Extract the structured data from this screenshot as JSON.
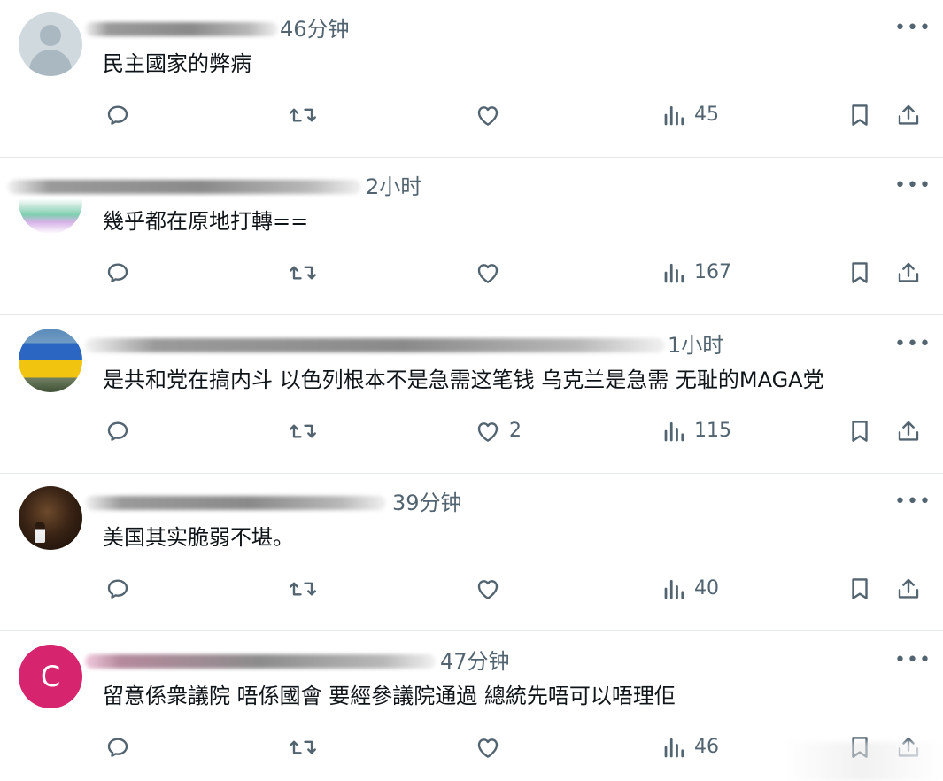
{
  "posts": [
    {
      "avatar": "default-user-avatar",
      "timestamp": "46分钟",
      "text": "民主國家的弊病",
      "likes": "",
      "views": "45"
    },
    {
      "avatar": "crowd-photo-avatar",
      "timestamp": "2小时",
      "text": "幾乎都在原地打轉==",
      "likes": "",
      "views": "167"
    },
    {
      "avatar": "ukraine-flag-avatar",
      "timestamp": "1小时",
      "text": "是共和党在搞内斗 以色列根本不是急需这笔钱 乌克兰是急需 无耻的MAGA党",
      "likes": "2",
      "views": "115"
    },
    {
      "avatar": "dark-photo-avatar",
      "timestamp": "39分钟",
      "text": "美国其实脆弱不堪。",
      "likes": "",
      "views": "40"
    },
    {
      "avatar": "letter-avatar",
      "avatar_letter": "C",
      "avatar_color": "#d6246e",
      "timestamp": "47分钟",
      "text": "留意係衆議院 唔係國會 要經參議院通過 總統先唔可以唔理佢",
      "likes": "",
      "views": "46"
    }
  ],
  "more_label": "•••",
  "colors": {
    "text": "#0f1419",
    "secondary": "#536471",
    "divider": "#e6e9ec"
  },
  "icons": {
    "reply": "reply-icon",
    "repost": "repost-icon",
    "like": "heart-icon",
    "views": "views-icon",
    "bookmark": "bookmark-icon",
    "share": "share-icon"
  }
}
